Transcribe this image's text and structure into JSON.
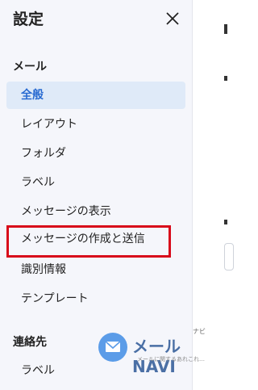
{
  "sidebar": {
    "title": "設定",
    "sections": [
      {
        "label": "メール"
      },
      {
        "label": "連絡先"
      }
    ],
    "mail_items": [
      {
        "label": "全般",
        "active": true
      },
      {
        "label": "レイアウト"
      },
      {
        "label": "フォルダ"
      },
      {
        "label": "ラベル"
      },
      {
        "label": "メッセージの表示"
      },
      {
        "label": "メッセージの作成と送信",
        "highlighted": true
      },
      {
        "label": "識別情報"
      },
      {
        "label": "テンプレート"
      }
    ],
    "contact_items": [
      {
        "label": "ラベル"
      }
    ]
  },
  "watermark": {
    "brand": "メールNAVI",
    "ruby": "ナビ",
    "tagline": "メールに関するあれこれ…"
  },
  "colors": {
    "accent": "#2a6bd1",
    "active_bg": "#dfeaf8",
    "highlight_border": "#d8091a",
    "sidebar_bg": "#f5f6fb"
  },
  "icons": {
    "close": "close-icon",
    "logo": "mail-envelope-icon"
  }
}
